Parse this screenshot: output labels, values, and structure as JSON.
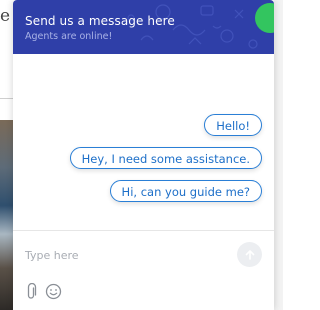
{
  "background_page": {
    "partial_letter": "e"
  },
  "chat": {
    "header": {
      "title": "Send us a message here",
      "subtitle": "Agents are online!",
      "status_color": "#33c55f",
      "background_color": "#2f3fa8"
    },
    "messages": [
      {
        "text": "Hello!"
      },
      {
        "text": "Hey, I need some assistance."
      },
      {
        "text": "Hi, can you guide me?"
      }
    ],
    "composer": {
      "placeholder": "Type here",
      "send_icon": "arrow-up-icon",
      "attach_icon": "paperclip-icon",
      "emoji_icon": "smiley-icon"
    },
    "accent_color": "#2a7fd6"
  }
}
